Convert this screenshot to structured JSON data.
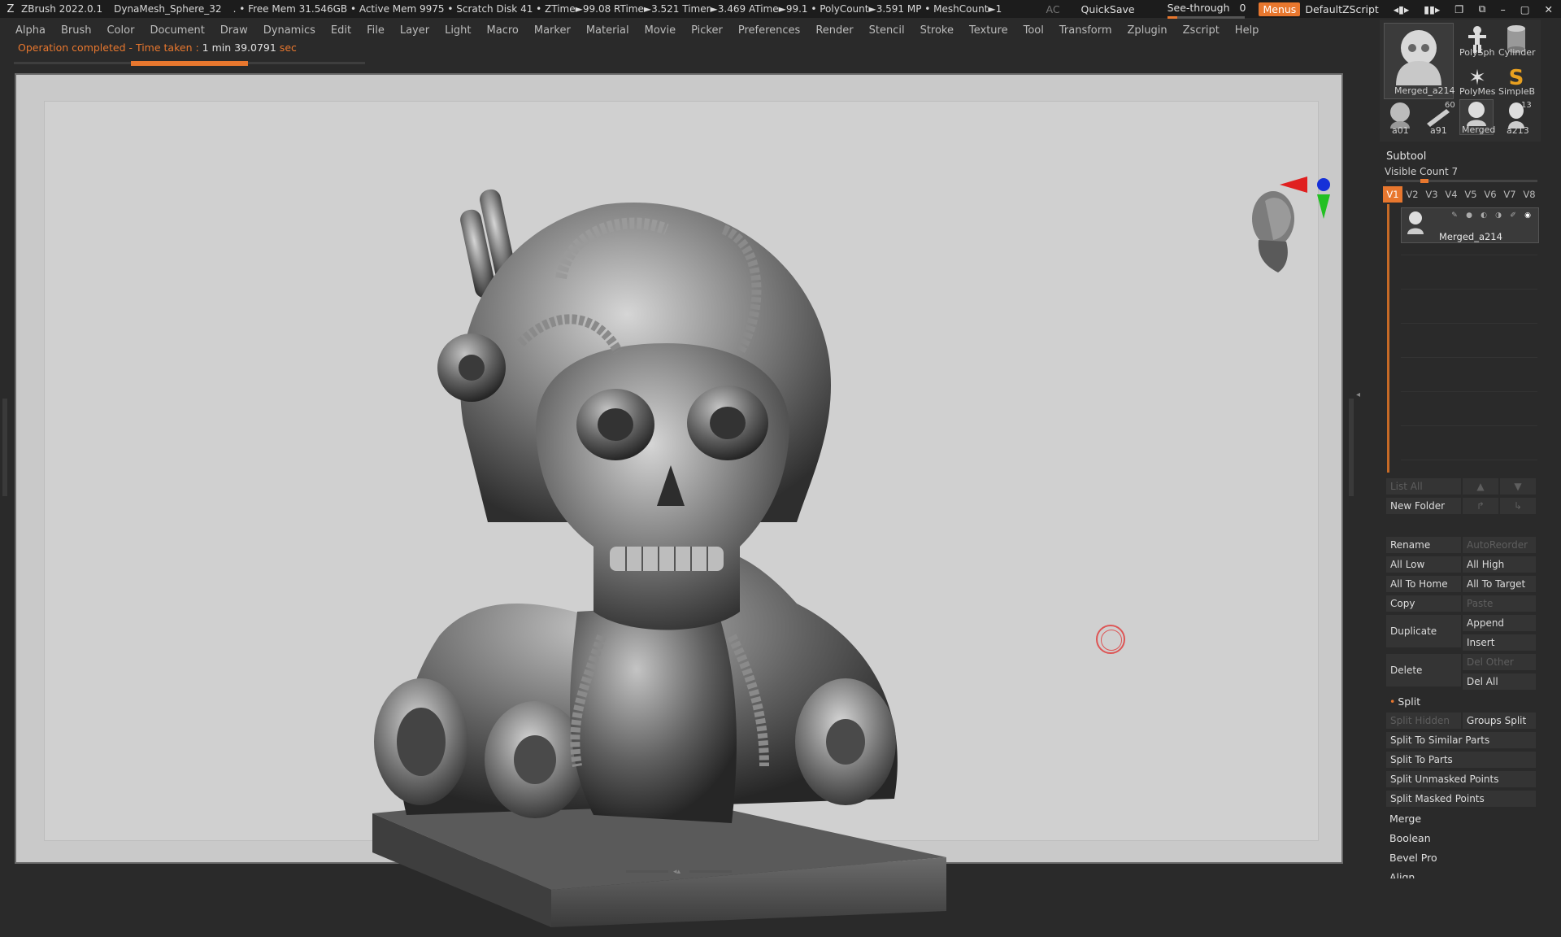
{
  "titlebar": {
    "app": "ZBrush 2022.0.1",
    "doc": "DynaMesh_Sphere_32",
    "stats": ". • Free Mem 31.546GB • Active Mem 9975 • Scratch Disk 41 • ZTime►99.08 RTime►3.521 Timer►3.469 ATime►99.1 • PolyCount►3.591 MP • MeshCount►1",
    "ac": "AC",
    "quicksave": "QuickSave",
    "seethrough": "See-through",
    "seethrough_value": "0",
    "menus": "Menus",
    "script": "DefaultZScript"
  },
  "menubar": [
    "Alpha",
    "Brush",
    "Color",
    "Document",
    "Draw",
    "Dynamics",
    "Edit",
    "File",
    "Layer",
    "Light",
    "Macro",
    "Marker",
    "Material",
    "Movie",
    "Picker",
    "Preferences",
    "Render",
    "Stencil",
    "Stroke",
    "Texture",
    "Tool",
    "Transform",
    "Zplugin",
    "Zscript",
    "Help"
  ],
  "notice": {
    "prefix": "Operation completed - Time taken : ",
    "value": "1 min 39.0791",
    "suffix": " sec"
  },
  "progress": 0.333,
  "tools": {
    "current": "Merged_a214",
    "polysphere": "PolySph",
    "cylinder": "Cylinder",
    "polymesh": "PolyMes",
    "simpleb": "SimpleB",
    "a01": "a01",
    "a91": "a91",
    "merged": "Merged",
    "a213": "a213",
    "badge_60": "60",
    "badge_13": "13"
  },
  "subtool": {
    "title": "Subtool",
    "visible_count": "Visible Count 7",
    "tabs": [
      "V1",
      "V2",
      "V3",
      "V4",
      "V5",
      "V6",
      "V7",
      "V8"
    ],
    "active_tab": "V1",
    "item_name": "Merged_a214",
    "list_all": "List All",
    "new_folder": "New Folder",
    "rename": "Rename",
    "auto_reorder": "AutoReorder",
    "all_low": "All Low",
    "all_high": "All High",
    "all_to_home": "All To Home",
    "all_to_target": "All To Target",
    "copy": "Copy",
    "paste": "Paste",
    "duplicate": "Duplicate",
    "append": "Append",
    "insert": "Insert",
    "delete": "Delete",
    "del_other": "Del Other",
    "del_all": "Del All",
    "split": "Split",
    "split_hidden": "Split Hidden",
    "groups_split": "Groups Split",
    "split_similar": "Split To Similar Parts",
    "split_parts": "Split To Parts",
    "split_unmasked": "Split Unmasked Points",
    "split_masked": "Split Masked Points",
    "merge": "Merge",
    "boolean": "Boolean",
    "bevel_pro": "Bevel Pro",
    "align": "Align"
  },
  "colors": {
    "accent": "#e8772e",
    "canvas": "#d0d0d0",
    "panel": "#2a2a2a"
  }
}
